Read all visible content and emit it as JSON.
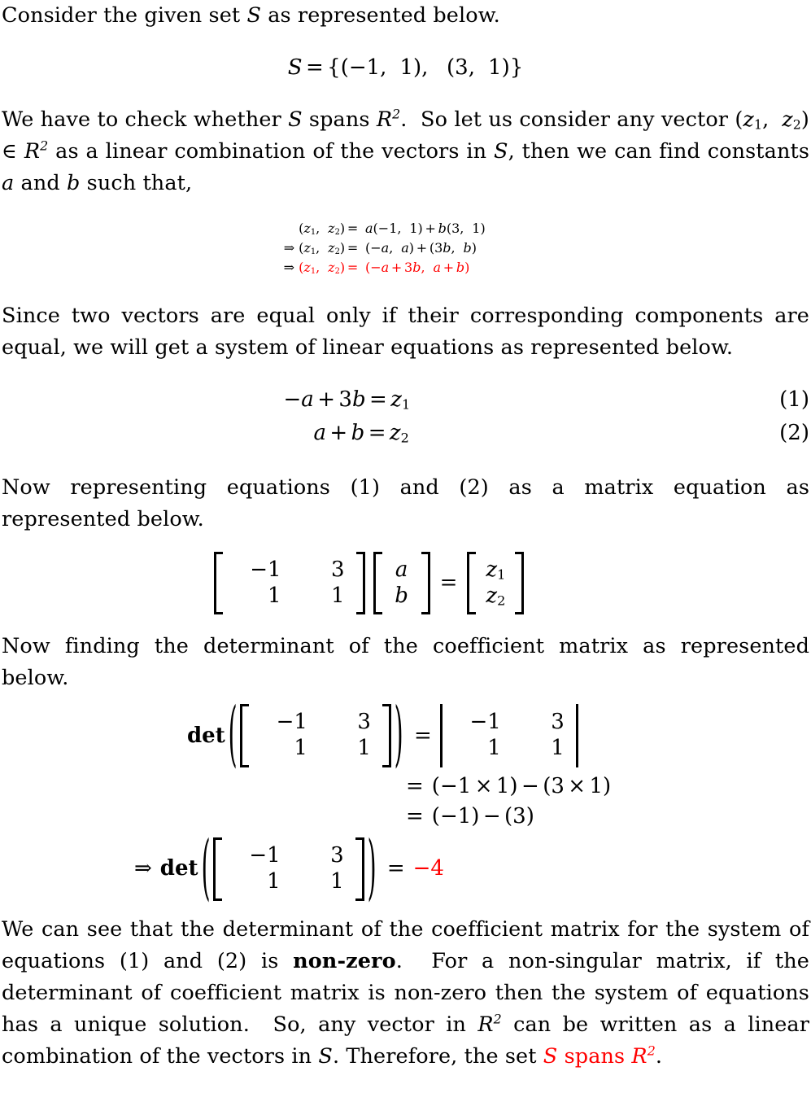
{
  "document": {
    "accent_color": "#ff0000",
    "text_color": "#000000",
    "background": "#ffffff"
  },
  "intro": {
    "line": "Consider the given set S as represented below."
  },
  "set_equation": {
    "lhs": "S",
    "eq": "=",
    "rhs": "{(−1,  1),  (3,  1)}",
    "full": "S = {(−1, 1), (3, 1)}"
  },
  "paragraph_2": {
    "text": "We have to check whether S spans R2. So let us consider any vector (z1, z2) ∈ R2 as a linear combination of the vectors in S, then we can find constants a and b such that,",
    "seg_1": "We have to check whether",
    "var_s_1": "S",
    "seg_2": "spans",
    "var_r_1": "R",
    "pow_1": "2",
    "seg_3": ". So let us consider any vector",
    "vec_open": "(",
    "var_z1": "z",
    "sub_1": "1",
    "comma": ",",
    "var_z2": "z",
    "sub_2": "2",
    "vec_close": ")",
    "elem": "∈",
    "var_r_2": "R",
    "pow_2": "2",
    "seg_4": "as a linear combination of the vectors in",
    "var_s_2": "S",
    "seg_5": ", then we can find constants",
    "var_a": "a",
    "seg_6": "and",
    "var_b": "b",
    "seg_7": "such that,"
  },
  "derivation": {
    "rows": [
      {
        "arrow": "",
        "lhs": "(z1,  z2) =",
        "rhs": "a(−1,  1) + b(3,  1)",
        "color": "#000000"
      },
      {
        "arrow": "⇒",
        "lhs": "(z1,  z2) =",
        "rhs": "(−a,  a) + (3b,  b)",
        "color": "#000000"
      },
      {
        "arrow": "⇒",
        "lhs": "(z1,  z2) =",
        "rhs": "(−a + 3b,  a + b)",
        "color": "#ff0000"
      }
    ]
  },
  "paragraph_3": {
    "text": "Since two vectors are equal only if their corresponding components are equal, we will get a system of linear equations as represented below."
  },
  "system": {
    "equations": [
      {
        "expr": "−a + 3b = z1",
        "tag": "(1)"
      },
      {
        "expr": "a + b = z2",
        "tag": "(2)"
      }
    ]
  },
  "paragraph_4": {
    "text": "Now representing equations (1) and (2) as a matrix equation as represented below."
  },
  "matrix_equation": {
    "coefficient_matrix": [
      [
        "−1",
        "3"
      ],
      [
        "1",
        "1"
      ]
    ],
    "unknown_vector": [
      "a",
      "b"
    ],
    "equals": "=",
    "result_vector": [
      "z1",
      "z2"
    ],
    "unknown_vector_parts": [
      {
        "base": "a",
        "sub": ""
      },
      {
        "base": "b",
        "sub": ""
      }
    ],
    "result_vector_parts": [
      {
        "base": "z",
        "sub": "1"
      },
      {
        "base": "z",
        "sub": "2"
      }
    ]
  },
  "paragraph_5": {
    "text": "Now finding the determinant of the coefficient matrix as represented below."
  },
  "determinant": {
    "det_label": "det",
    "matrix": [
      [
        "−1",
        "3"
      ],
      [
        "1",
        "1"
      ]
    ],
    "steps": [
      {
        "lhs": "det( [ −1 3 ; 1 1 ] )",
        "rhs_type": "determinant-bars"
      },
      {
        "lhs": "",
        "rhs": "(−1 × 1) − (3 × 1)"
      },
      {
        "lhs": "",
        "rhs": "(−1) − (3)"
      }
    ],
    "step_2_text": "(−1 × 1) − (3 × 1)",
    "step_3_text": "(−1) − (3)",
    "final": {
      "arrow": "⇒",
      "det_label": "det",
      "equals": "=",
      "value": "−4",
      "value_color": "#ff0000"
    }
  },
  "paragraph_6": {
    "seg_1": "We can see that the determinant of the coefficient matrix for the system of equations (1) and (2) is",
    "bold_1": "non-zero",
    "seg_2": ". For a non-singular matrix, if the determinant of coefficient matrix is non-zero then the system of equations has a unique solution. So, any vector in",
    "var_r": "R",
    "pow": "2",
    "seg_3": "can be written as a linear combination of the vectors in",
    "var_s": "S",
    "seg_4": ". Therefore, the set",
    "red_s": "S",
    "red_spans": "spans",
    "red_r": "R",
    "red_pow": "2",
    "period": "."
  }
}
